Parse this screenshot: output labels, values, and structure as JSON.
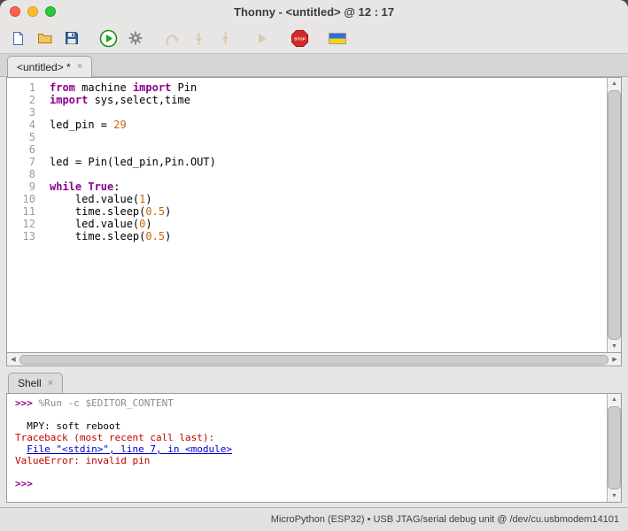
{
  "window": {
    "title": "Thonny - <untitled> @ 12 : 17"
  },
  "toolbar": {
    "buttons": [
      {
        "name": "new-file",
        "glyph": "new",
        "disabled": false,
        "gap": false
      },
      {
        "name": "open-file",
        "glyph": "open",
        "disabled": false,
        "gap": false
      },
      {
        "name": "save-file",
        "glyph": "save",
        "disabled": false,
        "gap": false
      },
      {
        "name": "run-script",
        "glyph": "run",
        "disabled": false,
        "gap": true
      },
      {
        "name": "debug-script",
        "glyph": "debug",
        "disabled": false,
        "gap": false
      },
      {
        "name": "step-over",
        "glyph": "step-over",
        "disabled": true,
        "gap": true
      },
      {
        "name": "step-into",
        "glyph": "step-into",
        "disabled": true,
        "gap": false
      },
      {
        "name": "step-out",
        "glyph": "step-out",
        "disabled": true,
        "gap": false
      },
      {
        "name": "resume",
        "glyph": "resume",
        "disabled": true,
        "gap": true
      },
      {
        "name": "stop-restart",
        "glyph": "stop",
        "disabled": false,
        "gap": true
      },
      {
        "name": "support-ukraine",
        "glyph": "flag",
        "disabled": false,
        "gap": true
      }
    ]
  },
  "editor_tab": {
    "label": "<untitled> *"
  },
  "editor": {
    "lines": [
      [
        [
          "kw",
          "from"
        ],
        [
          "plain",
          " machine "
        ],
        [
          "kw",
          "import"
        ],
        [
          "plain",
          " Pin"
        ]
      ],
      [
        [
          "kw",
          "import"
        ],
        [
          "plain",
          " sys,select,time"
        ]
      ],
      [],
      [
        [
          "plain",
          "led_pin = "
        ],
        [
          "num",
          "29"
        ]
      ],
      [],
      [],
      [
        [
          "plain",
          "led = Pin(led_pin,Pin.OUT)"
        ]
      ],
      [],
      [
        [
          "kw",
          "while"
        ],
        [
          "plain",
          " "
        ],
        [
          "kw",
          "True"
        ],
        [
          "plain",
          ":"
        ]
      ],
      [
        [
          "plain",
          "    led.value("
        ],
        [
          "num",
          "1"
        ],
        [
          "plain",
          ")"
        ]
      ],
      [
        [
          "plain",
          "    time.sleep("
        ],
        [
          "num",
          "0.5"
        ],
        [
          "plain",
          ")"
        ]
      ],
      [
        [
          "plain",
          "    led.value("
        ],
        [
          "num",
          "0"
        ],
        [
          "plain",
          ")"
        ]
      ],
      [
        [
          "plain",
          "    time.sleep("
        ],
        [
          "num",
          "0.5"
        ],
        [
          "plain",
          ")"
        ]
      ]
    ]
  },
  "shell": {
    "tab_label": "Shell",
    "lines": [
      [
        [
          "prompt",
          ">>> "
        ],
        [
          "cmd",
          "%Run -c $EDITOR_CONTENT"
        ]
      ],
      [],
      [
        [
          "out",
          "  MPY: soft reboot"
        ]
      ],
      [
        [
          "err",
          "Traceback (most recent call last):"
        ]
      ],
      [
        [
          "errplain",
          "  "
        ],
        [
          "link",
          "File \"<stdin>\", line 7, in <module>"
        ]
      ],
      [
        [
          "err",
          "ValueError: invalid pin"
        ]
      ],
      [],
      [
        [
          "prompt",
          ">>> "
        ]
      ]
    ]
  },
  "statusbar": {
    "text": "MicroPython (ESP32)  •  USB JTAG/serial debug unit @ /dev/cu.usbmodem14101"
  },
  "colors": {
    "keyword": "#8b008b",
    "number": "#c9640a",
    "prompt": "#8b008b",
    "stderr": "#c00000",
    "link_blue": "#0000cc",
    "run_green": "#1fa31f",
    "stop_red": "#d42a2a",
    "flag_blue": "#2f6fde",
    "flag_yellow": "#f7d117"
  }
}
